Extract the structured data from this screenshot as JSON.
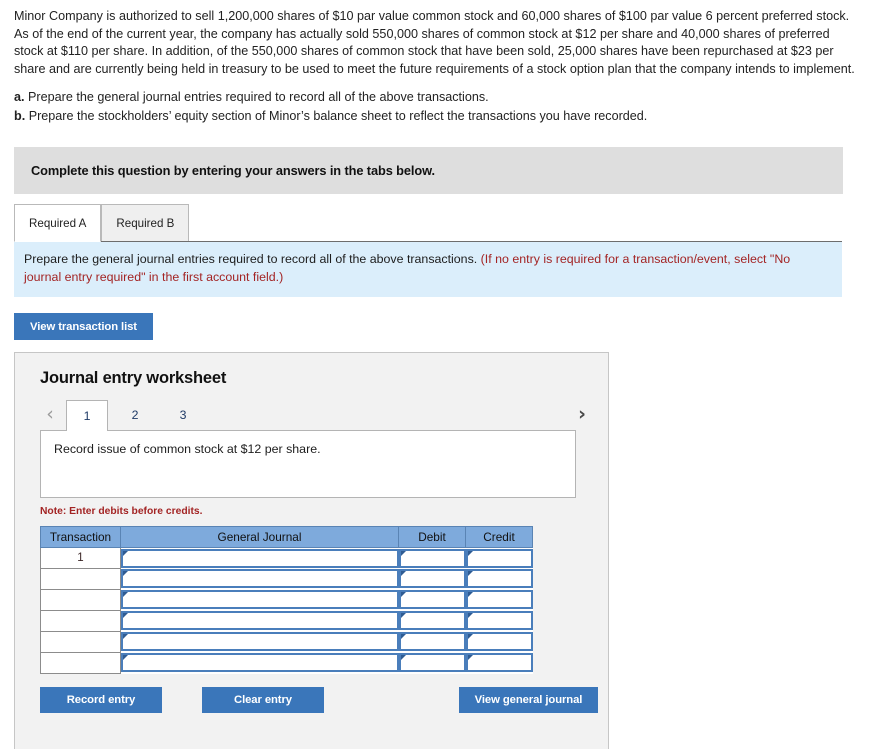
{
  "problem": {
    "text": "Minor Company is authorized to sell 1,200,000 shares of $10 par value common stock and 60,000 shares of $100 par value 6 percent preferred stock. As of the end of the current year, the company has actually sold 550,000 shares of common stock at $12 per share and 40,000 shares of preferred stock at $110 per share. In addition, of the 550,000 shares of common stock that have been sold, 25,000 shares have been repurchased at $23 per share and are currently being held in treasury to be used to meet the future requirements of a stock option plan that the company intends to implement."
  },
  "requirements": [
    {
      "letter": "a.",
      "text": "Prepare the general journal entries required to record all of the above transactions."
    },
    {
      "letter": "b.",
      "text": "Prepare the stockholders’ equity section of Minor’s balance sheet to reflect the transactions you have recorded."
    }
  ],
  "banner": {
    "text": "Complete this question by entering your answers in the tabs below."
  },
  "tabs": [
    {
      "label": "Required A",
      "active": true
    },
    {
      "label": "Required B",
      "active": false
    }
  ],
  "instruction": {
    "main": "Prepare the general journal entries required to record all of the above transactions.",
    "hint": "(If no entry is required for a transaction/event, select \"No journal entry required\" in the first account field.)"
  },
  "buttons": {
    "view_transaction_list": "View transaction list",
    "record_entry": "Record entry",
    "clear_entry": "Clear entry",
    "view_general_journal": "View general journal"
  },
  "worksheet": {
    "title": "Journal entry worksheet",
    "pager": {
      "prev_icon": "chevron-left-icon",
      "next_icon": "chevron-right-icon",
      "prev_glyph": "‹",
      "next_glyph": "›",
      "pages": [
        "1",
        "2",
        "3"
      ],
      "active_page": "1"
    },
    "description": "Record issue of common stock at $12 per share.",
    "note": "Note: Enter debits before credits.",
    "table": {
      "headers": [
        "Transaction",
        "General Journal",
        "Debit",
        "Credit"
      ],
      "rows": [
        {
          "transaction": "1",
          "general_journal": "",
          "debit": "",
          "credit": ""
        },
        {
          "transaction": "",
          "general_journal": "",
          "debit": "",
          "credit": ""
        },
        {
          "transaction": "",
          "general_journal": "",
          "debit": "",
          "credit": ""
        },
        {
          "transaction": "",
          "general_journal": "",
          "debit": "",
          "credit": ""
        },
        {
          "transaction": "",
          "general_journal": "",
          "debit": "",
          "credit": ""
        },
        {
          "transaction": "",
          "general_journal": "",
          "debit": "",
          "credit": ""
        }
      ]
    }
  },
  "colors": {
    "accent_blue": "#3a76ba",
    "header_blue": "#7eaadc",
    "instruction_bg": "#dbeefb",
    "banner_bg": "#dedede",
    "hint_red": "#a32424"
  }
}
